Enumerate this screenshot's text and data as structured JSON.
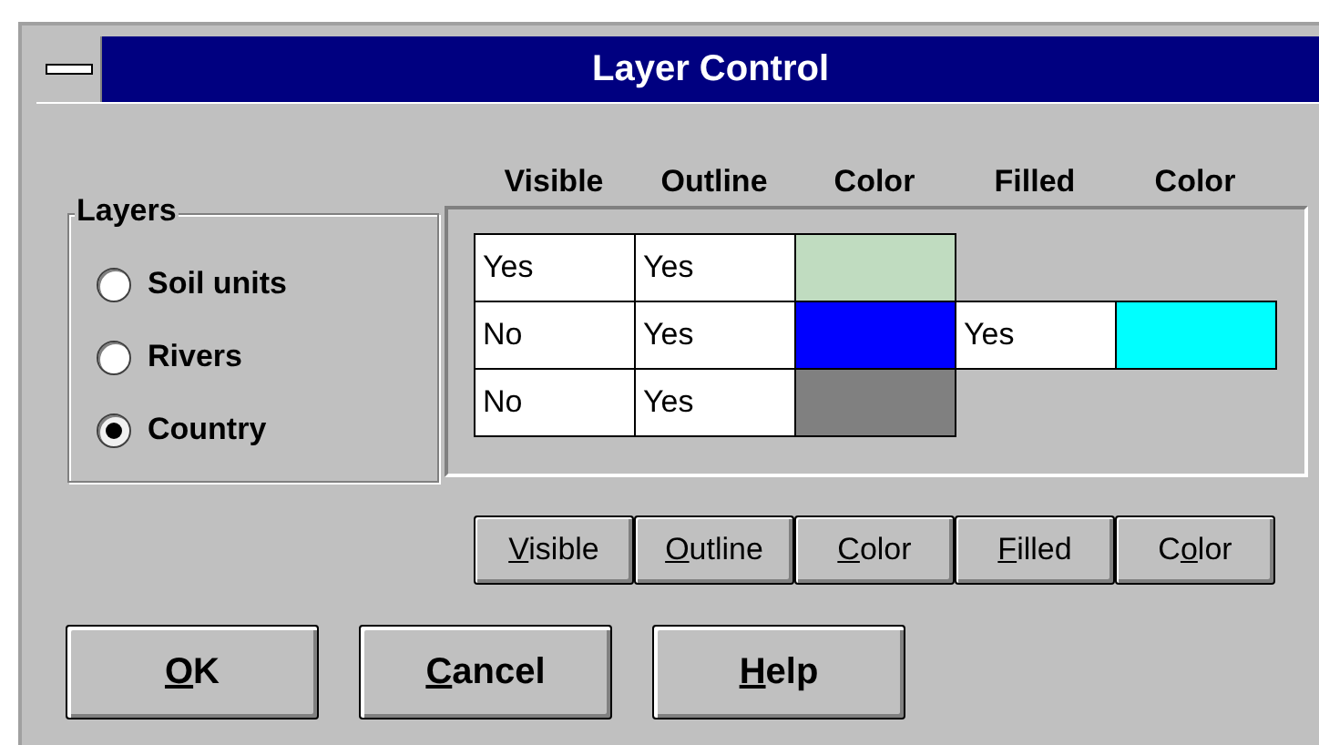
{
  "window": {
    "title": "Layer Control"
  },
  "columns": [
    "Visible",
    "Outline",
    "Color",
    "Filled",
    "Color"
  ],
  "layers": {
    "title": "Layers",
    "items": [
      {
        "label": "Soil units",
        "selected": false
      },
      {
        "label": "Rivers",
        "selected": false
      },
      {
        "label": "Country",
        "selected": true
      }
    ]
  },
  "table": {
    "rows": [
      {
        "cells": [
          {
            "kind": "text",
            "text": "Yes"
          },
          {
            "kind": "text",
            "text": "Yes"
          },
          {
            "kind": "swatch",
            "color": "#c0dcc0"
          }
        ]
      },
      {
        "cells": [
          {
            "kind": "text",
            "text": "No"
          },
          {
            "kind": "text",
            "text": "Yes"
          },
          {
            "kind": "swatch",
            "color": "#0000ff"
          },
          {
            "kind": "text",
            "text": "Yes"
          },
          {
            "kind": "swatch",
            "color": "#00ffff"
          }
        ]
      },
      {
        "cells": [
          {
            "kind": "text",
            "text": "No"
          },
          {
            "kind": "text",
            "text": "Yes"
          },
          {
            "kind": "swatch",
            "color": "#808080"
          }
        ]
      }
    ]
  },
  "column_buttons": [
    {
      "key": "V",
      "rest": "isible"
    },
    {
      "key": "O",
      "rest": "utline"
    },
    {
      "key": "C",
      "rest": "olor"
    },
    {
      "key": "F",
      "rest": "illed"
    },
    {
      "before": "C",
      "key": "o",
      "rest": "lor"
    }
  ],
  "buttons": [
    {
      "key": "O",
      "rest": "K"
    },
    {
      "key": "C",
      "rest": "ancel"
    },
    {
      "key": "H",
      "rest": "elp"
    }
  ]
}
